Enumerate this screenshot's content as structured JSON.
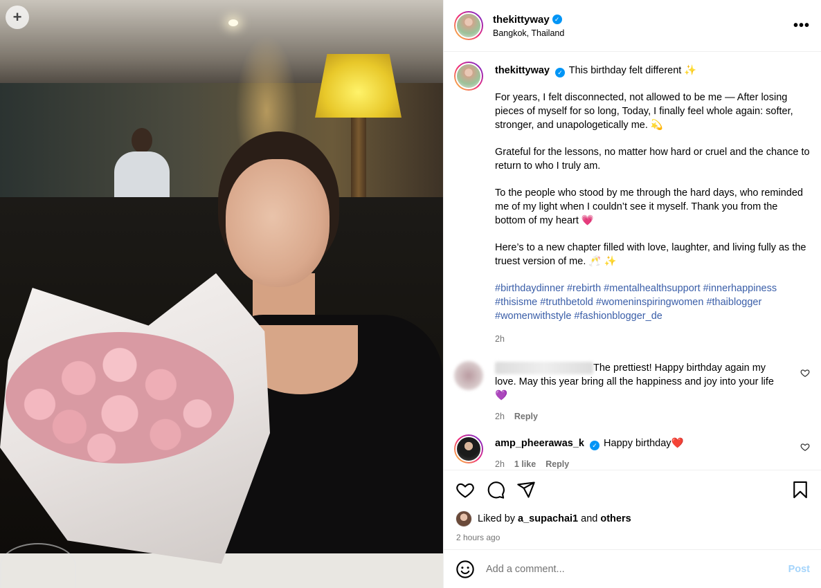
{
  "post": {
    "username": "thekittyway",
    "location": "Bangkok, Thailand",
    "more_label": "•••"
  },
  "caption": {
    "username": "thekittyway",
    "line1": "This birthday felt different ✨",
    "para1": "For years, I felt disconnected, not allowed to be me — After losing pieces of myself for so long, Today, I finally feel whole again: softer, stronger, and unapologetically me. 💫",
    "para2": "Grateful for the lessons, no matter how hard or cruel and the chance to return to who I truly am.",
    "para3": "To the people who stood by me through the hard days, who reminded me of my light when I couldn’t see it myself. Thank you from the bottom of my heart 💗",
    "para4": "Here’s to a new chapter filled with love, laughter, and living fully as the truest version of me. 🥂 ✨",
    "hashtags": "#birthdaydinner #rebirth #mentalhealthsupport #innerhappiness #thisisme #truthbetold #womeninspiringwomen #thaiblogger #womenwithstyle #fashionblogger_de",
    "time": "2h"
  },
  "comments": [
    {
      "text": "The prettiest! Happy birthday again my love. May this year bring all the happiness and joy into your life 💜",
      "time": "2h",
      "reply": "Reply"
    },
    {
      "username": "amp_pheerawas_k",
      "text": "Happy birthday❤️",
      "time": "2h",
      "likes": "1 like",
      "reply": "Reply"
    }
  ],
  "likes": {
    "prefix": "Liked by",
    "user": "a_supachai1",
    "and": "and",
    "others": "others",
    "time_ago": "2 hours ago"
  },
  "composer": {
    "placeholder": "Add a comment...",
    "post_label": "Post"
  },
  "photo": {
    "save_badge": "+"
  }
}
